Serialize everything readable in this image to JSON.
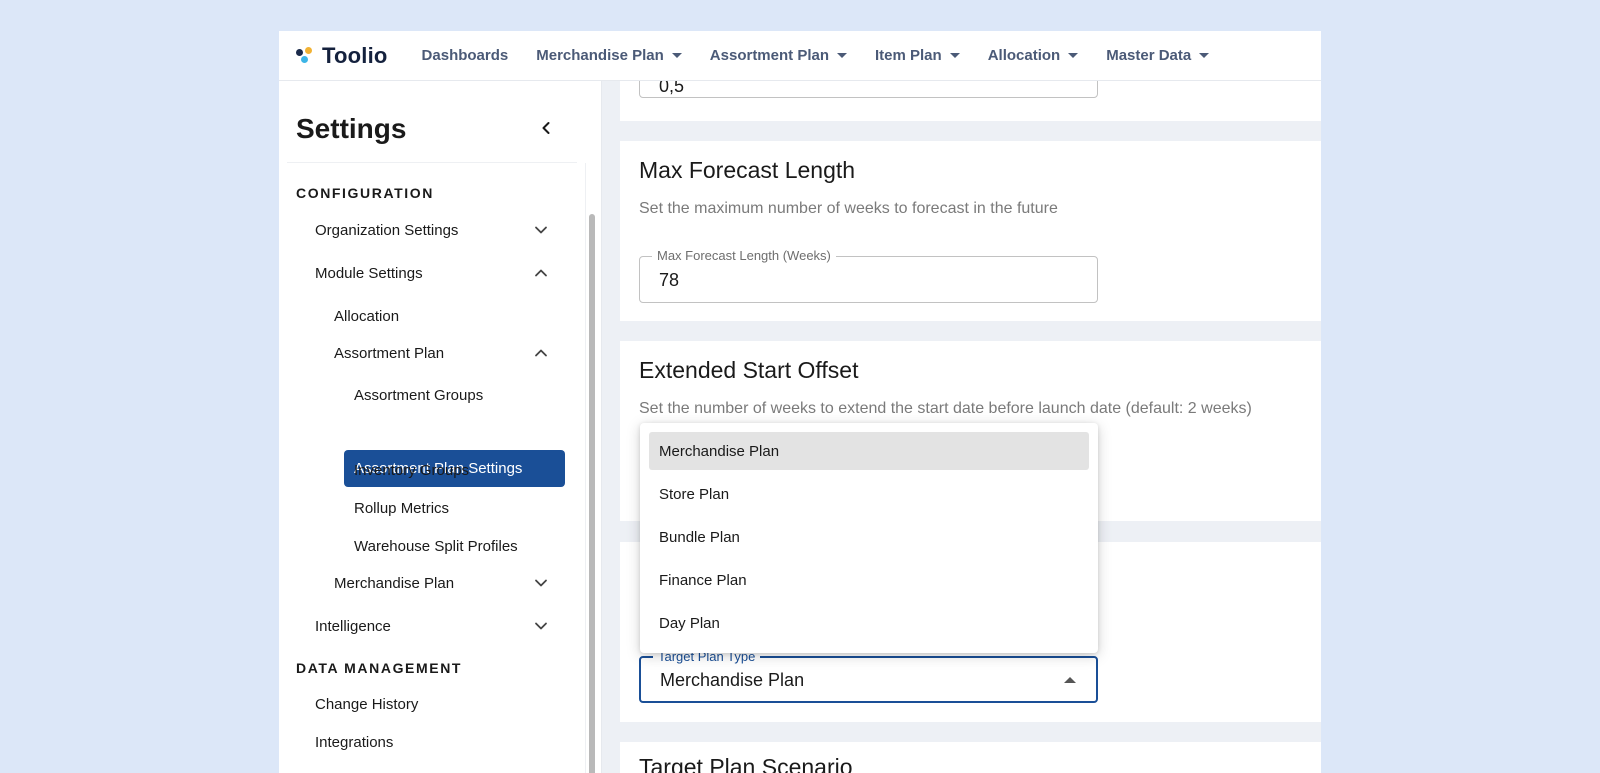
{
  "app": {
    "logo_text": "Toolio"
  },
  "nav": {
    "items": [
      {
        "label": "Dashboards",
        "has_caret": false
      },
      {
        "label": "Merchandise Plan",
        "has_caret": true
      },
      {
        "label": "Assortment Plan",
        "has_caret": true
      },
      {
        "label": "Item Plan",
        "has_caret": true
      },
      {
        "label": "Allocation",
        "has_caret": true
      },
      {
        "label": "Master Data",
        "has_caret": true
      }
    ]
  },
  "sidebar": {
    "title": "Settings",
    "sections": [
      {
        "label": "CONFIGURATION"
      },
      {
        "label": "DATA MANAGEMENT"
      }
    ],
    "items": [
      {
        "label": "Organization Settings",
        "level": 1,
        "chevron": "down"
      },
      {
        "label": "Module Settings",
        "level": 1,
        "chevron": "up"
      },
      {
        "label": "Allocation",
        "level": 2,
        "chevron": ""
      },
      {
        "label": "Assortment Plan",
        "level": 2,
        "chevron": "up"
      },
      {
        "label": "Assortment Groups",
        "level": 3,
        "chevron": ""
      },
      {
        "label": "Assortment Plan Settings",
        "level": 3,
        "chevron": "",
        "active": true
      },
      {
        "label": "Inventory Groups",
        "level": 3,
        "chevron": ""
      },
      {
        "label": "Rollup Metrics",
        "level": 3,
        "chevron": ""
      },
      {
        "label": "Warehouse Split Profiles",
        "level": 3,
        "chevron": ""
      },
      {
        "label": "Merchandise Plan",
        "level": 2,
        "chevron": "down"
      },
      {
        "label": "Intelligence",
        "level": 1,
        "chevron": "down"
      },
      {
        "label": "Change History",
        "level": 1,
        "chevron": ""
      },
      {
        "label": "Integrations",
        "level": 1,
        "chevron": ""
      }
    ]
  },
  "main": {
    "partial_field_value": "0,5",
    "max_forecast": {
      "title": "Max Forecast Length",
      "description": "Set the maximum number of weeks to forecast in the future",
      "field_label": "Max Forecast Length (Weeks)",
      "field_value": "78"
    },
    "extended_start": {
      "title": "Extended Start Offset",
      "description": "Set the number of weeks to extend the start date before launch date (default: 2 weeks)"
    },
    "target_plan_type": {
      "field_label": "Target Plan Type",
      "selected": "Merchandise Plan",
      "options": [
        "Merchandise Plan",
        "Store Plan",
        "Bundle Plan",
        "Finance Plan",
        "Day Plan"
      ]
    },
    "target_plan_scenario": {
      "title": "Target Plan Scenario"
    }
  },
  "colors": {
    "accent": "#1a4f97",
    "page_bg": "#dce7f8",
    "main_bg": "#edf0f5"
  }
}
